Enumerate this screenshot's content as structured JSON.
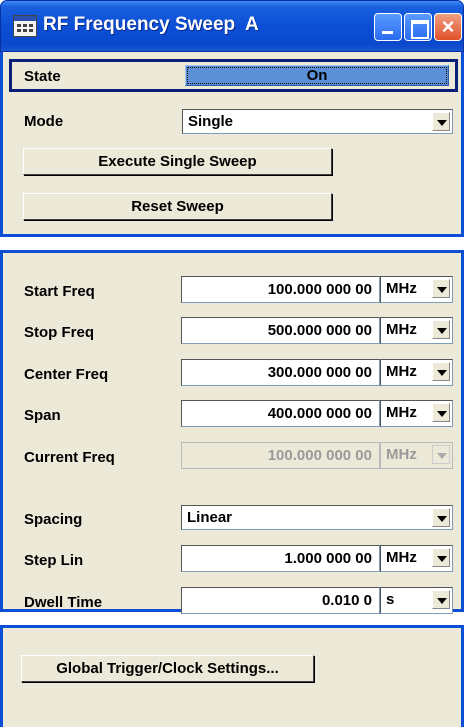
{
  "window": {
    "title": "RF Frequency Sweep  A",
    "close_glyph": "×"
  },
  "sweep": {
    "state_label": "State",
    "state_value": "On",
    "mode_label": "Mode",
    "mode_value": "Single",
    "execute_label": "Execute Single Sweep",
    "reset_label": "Reset Sweep"
  },
  "freq": {
    "start_label": "Start Freq",
    "start_value": "100.000 000 00",
    "start_unit": "MHz",
    "stop_label": "Stop Freq",
    "stop_value": "500.000 000 00",
    "stop_unit": "MHz",
    "center_label": "Center Freq",
    "center_value": "300.000 000 00",
    "center_unit": "MHz",
    "span_label": "Span",
    "span_value": "400.000 000 00",
    "span_unit": "MHz",
    "current_label": "Current Freq",
    "current_value": "100.000 000 00",
    "current_unit": "MHz",
    "spacing_label": "Spacing",
    "spacing_value": "Linear",
    "step_label": "Step Lin",
    "step_value": "1.000 000 00",
    "step_unit": "MHz",
    "dwell_label": "Dwell Time",
    "dwell_value": "0.010 0",
    "dwell_unit": "s"
  },
  "trigger": {
    "button_label": "Global Trigger/Clock Settings..."
  }
}
